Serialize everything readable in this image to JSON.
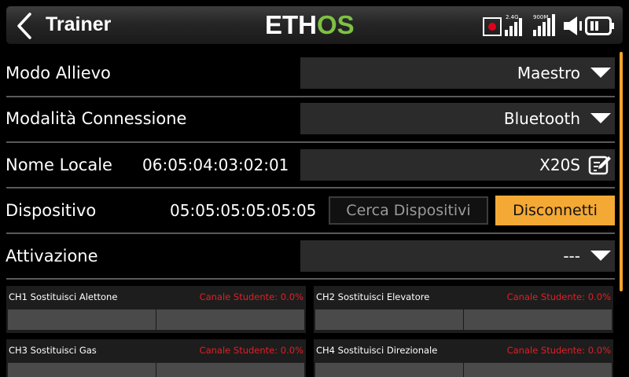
{
  "header": {
    "title": "Trainer",
    "logo_left": "ETH",
    "logo_right": "OS",
    "signal1_label": "2.4G",
    "signal2_label": "900M",
    "accent_color": "#7ec143"
  },
  "rows": {
    "mode": {
      "label": "Modo Allievo",
      "value": "Maestro"
    },
    "connection": {
      "label": "Modalità Connessione",
      "value": "Bluetooth"
    },
    "local_name": {
      "label": "Nome Locale",
      "address": "06:05:04:03:02:01",
      "value": "X20S"
    },
    "device": {
      "label": "Dispositivo",
      "address": "05:05:05:05:05:05",
      "search_label": "Cerca Dispositivi",
      "disconnect_label": "Disconnetti"
    },
    "activation": {
      "label": "Attivazione",
      "value": "---"
    }
  },
  "channels": [
    {
      "label": "CH1 Sostituisci Alettone",
      "value": "Canale Studente: 0.0%"
    },
    {
      "label": "CH2 Sostituisci Elevatore",
      "value": "Canale Studente: 0.0%"
    },
    {
      "label": "CH3 Sostituisci Gas",
      "value": "Canale Studente: 0.0%"
    },
    {
      "label": "CH4 Sostituisci Direzionale",
      "value": "Canale Studente: 0.0%"
    }
  ]
}
